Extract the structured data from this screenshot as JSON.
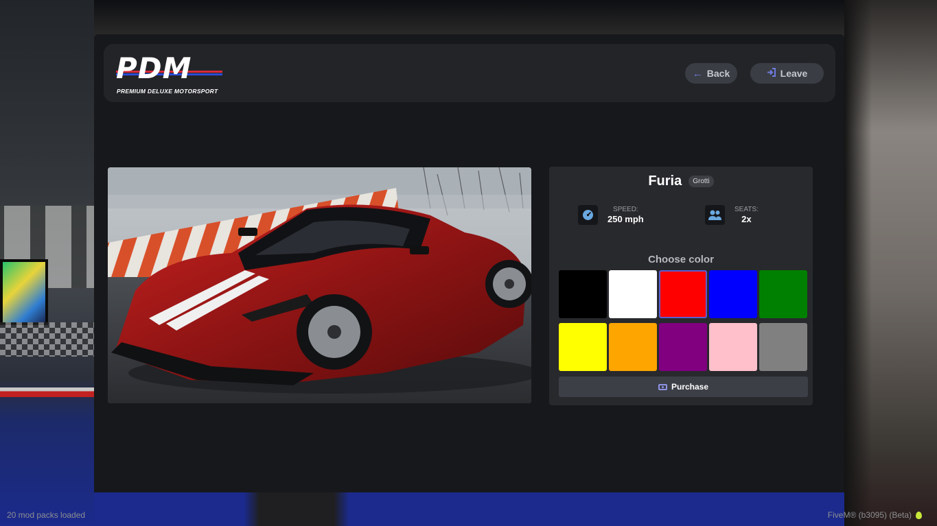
{
  "header": {
    "logo_text": "PDM",
    "logo_subtitle": "PREMIUM DELUXE MOTORSPORT",
    "back_label": "Back",
    "leave_label": "Leave"
  },
  "vehicle": {
    "name": "Furia",
    "brand": "Grotti",
    "speed_label": "SPEED:",
    "speed_value": "250 mph",
    "seats_label": "SEATS:",
    "seats_value": "2x"
  },
  "color_picker": {
    "title": "Choose color",
    "selected": "red",
    "colors": [
      {
        "name": "black",
        "hex": "#000000"
      },
      {
        "name": "white",
        "hex": "#ffffff"
      },
      {
        "name": "red",
        "hex": "#ff0000"
      },
      {
        "name": "blue",
        "hex": "#0000ff"
      },
      {
        "name": "green",
        "hex": "#008000"
      },
      {
        "name": "yellow",
        "hex": "#ffff00"
      },
      {
        "name": "orange",
        "hex": "#ffa500"
      },
      {
        "name": "purple",
        "hex": "#800080"
      },
      {
        "name": "pink",
        "hex": "#ffc0cb"
      },
      {
        "name": "gray",
        "hex": "#808080"
      }
    ]
  },
  "purchase_label": "Purchase",
  "status": {
    "left": "20 mod packs loaded",
    "right": "FiveM® (b3095) (Beta)"
  },
  "colors": {
    "accent": "#5b5fd0",
    "panel": "#17181b",
    "card": "#28292d"
  }
}
